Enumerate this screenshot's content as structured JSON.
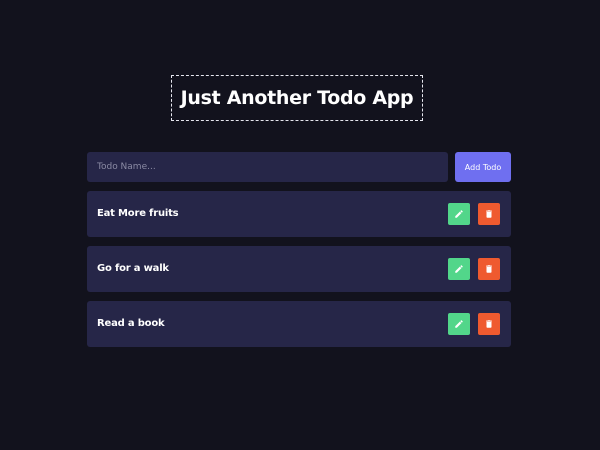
{
  "app": {
    "title": "Just Another Todo App"
  },
  "input": {
    "placeholder": "Todo Name...",
    "value": ""
  },
  "add_button": {
    "label": "Add Todo"
  },
  "todos": [
    {
      "text": "Eat More fruits",
      "edit_icon": "pencil-icon",
      "delete_icon": "trash-icon"
    },
    {
      "text": "Go for a walk",
      "edit_icon": "pencil-icon",
      "delete_icon": "trash-icon"
    },
    {
      "text": "Read a book",
      "edit_icon": "pencil-icon",
      "delete_icon": "trash-icon"
    }
  ],
  "colors": {
    "background": "#12121d",
    "card": "#262648",
    "accent": "#6f6ff0",
    "edit": "#52d68a",
    "delete": "#ef5a2f",
    "text": "#ffffff"
  }
}
